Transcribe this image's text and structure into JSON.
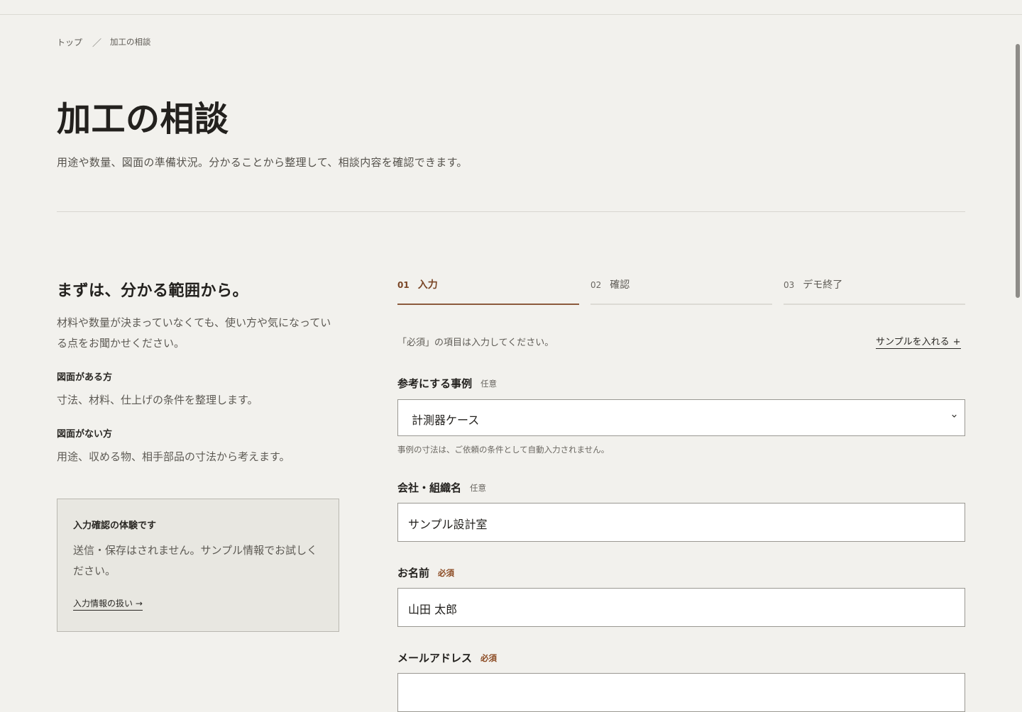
{
  "breadcrumb": {
    "home": "トップ",
    "separator": "／",
    "current": "加工の相談"
  },
  "page": {
    "title": "加工の相談",
    "lead": "用途や数量、図面の準備状況。分かることから整理して、相談内容を確認できます。"
  },
  "side": {
    "heading": "まずは、分かる範囲から。",
    "intro": "材料や数量が決まっていなくても、使い方や気になっている点をお聞かせください。",
    "with_drawing_title": "図面がある方",
    "with_drawing_text": "寸法、材料、仕上げの条件を整理します。",
    "without_drawing_title": "図面がない方",
    "without_drawing_text": "用途、収める物、相手部品の寸法から考えます。"
  },
  "note": {
    "title": "入力確認の体験です",
    "text": "送信・保存はされません。サンプル情報でお試しください。",
    "link": "入力情報の扱い →"
  },
  "steps": [
    {
      "num": "01",
      "label": "入力",
      "active": true
    },
    {
      "num": "02",
      "label": "確認",
      "active": false
    },
    {
      "num": "03",
      "label": "デモ終了",
      "active": false
    }
  ],
  "form": {
    "required_note": "「必須」の項目は入力してください。",
    "sample_button": "サンプルを入れる",
    "sample_plus": "+",
    "reference": {
      "label": "参考にする事例",
      "tag": "任意",
      "value": "計測器ケース",
      "hint": "事例の寸法は、ご依頼の条件として自動入力されません。"
    },
    "company": {
      "label": "会社・組織名",
      "tag": "任意",
      "value": "サンプル設計室"
    },
    "name": {
      "label": "お名前",
      "tag": "必須",
      "value": "山田 太郎"
    },
    "email": {
      "label": "メールアドレス",
      "tag": "必須",
      "value": ""
    }
  },
  "colors": {
    "background": "#f2f1ed",
    "accent": "#8b5a3c",
    "required": "#8b4a22"
  },
  "icons": {
    "select_arrow": "chevron-down-icon"
  }
}
